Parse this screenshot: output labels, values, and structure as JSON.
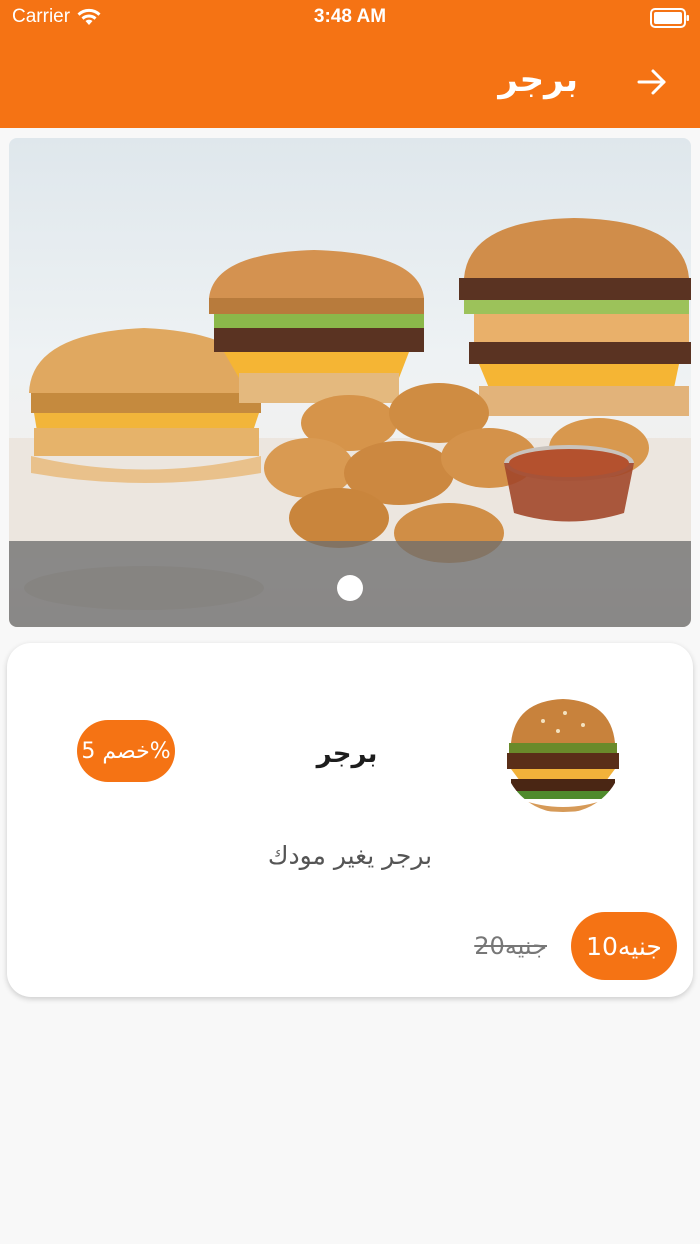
{
  "status_bar": {
    "carrier": "Carrier",
    "time": "3:48 AM",
    "wifi_icon": "wifi-icon",
    "battery_icon": "battery-icon"
  },
  "nav": {
    "title": "برجر",
    "back_icon": "arrow-right-icon"
  },
  "banner": {
    "page_count": 1,
    "current_page": 1
  },
  "product": {
    "title": "برجر",
    "discount_label": "خصم 5%",
    "description": "برجر يغير مودك",
    "price": "10جنيه",
    "old_price": "20جنيه"
  },
  "colors": {
    "accent": "#f57314",
    "background": "#f8f8f8",
    "card": "#ffffff"
  }
}
